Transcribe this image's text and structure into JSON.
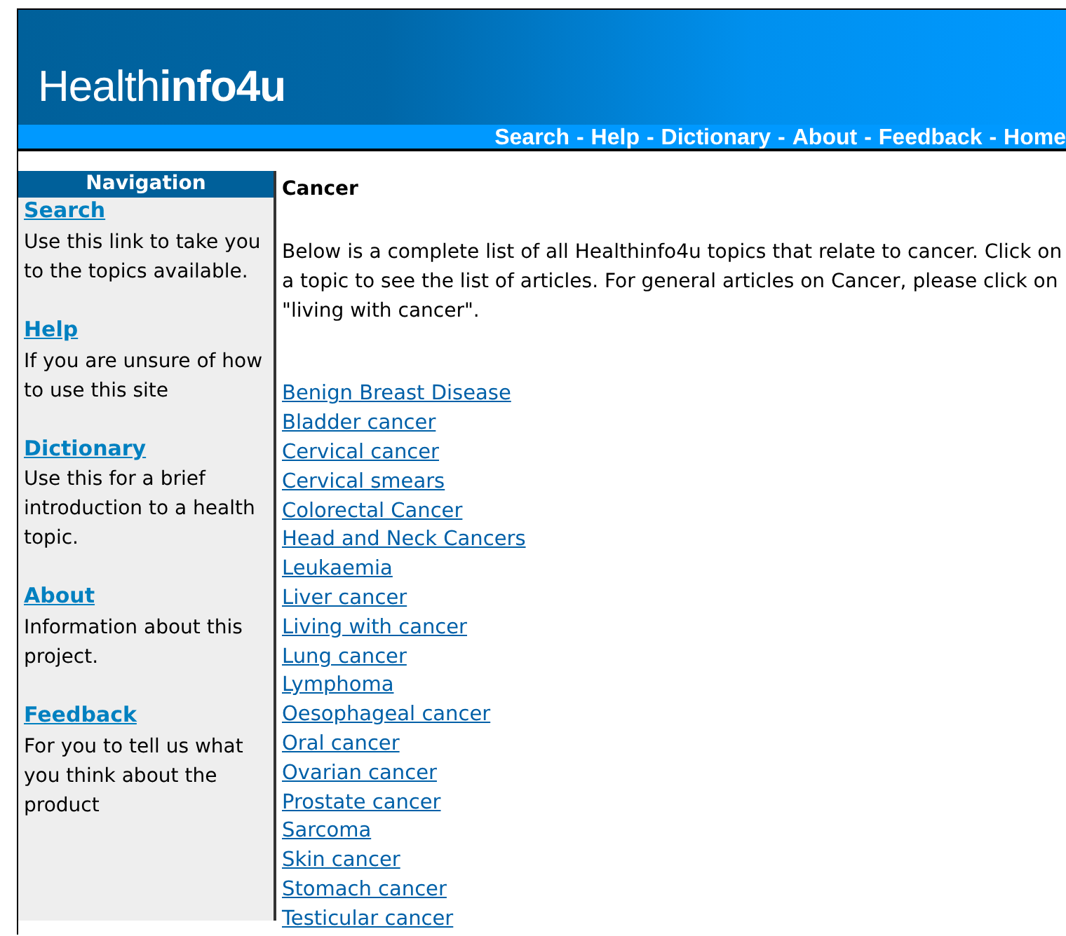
{
  "header": {
    "logo": "Health**info4u**"
  },
  "top_nav": [
    {
      "label": "Search",
      "separator": "-"
    },
    {
      "label": "Help",
      "separator": "-"
    },
    {
      "label": "Dictionary",
      "separator": "-"
    },
    {
      "label": "About",
      "separator": "-"
    },
    {
      "label": "Feedback",
      "separator": "-"
    },
    {
      "label": "Home"
    }
  ],
  "sidebar": {
    "title": "Navigation",
    "items": [
      {
        "link": "Search",
        "description": "Use this link to take you to the topics available."
      },
      {
        "link": "Help",
        "description": "If you are unsure of how to use this site"
      },
      {
        "link": "Dictionary",
        "description": "Use this for a brief introduction to a health topic."
      },
      {
        "link": "About",
        "description": "Information about this project."
      },
      {
        "link": "Feedback",
        "description": "For you to tell us what you think about the product"
      }
    ]
  },
  "content": {
    "heading": "Cancer",
    "intro": "Below is a complete list of all Healthinfo4u topics that relate to cancer. Click on a topic to see the list of articles. For general articles on Cancer, please click on \"living with cancer\".",
    "topics": [
      "Benign Breast Disease",
      "Bladder cancer",
      "Cervical cancer",
      "Cervical smears",
      "Colorectal Cancer",
      "Head and Neck Cancers",
      "Leukaemia",
      "Liver cancer",
      "Living with cancer",
      "Lung cancer",
      "Lymphoma",
      "Oesophageal cancer",
      "Oral cancer",
      "Ovarian cancer",
      "Prostate cancer",
      "Sarcoma",
      "Skin cancer",
      "Stomach cancer",
      "Testicular cancer"
    ]
  }
}
